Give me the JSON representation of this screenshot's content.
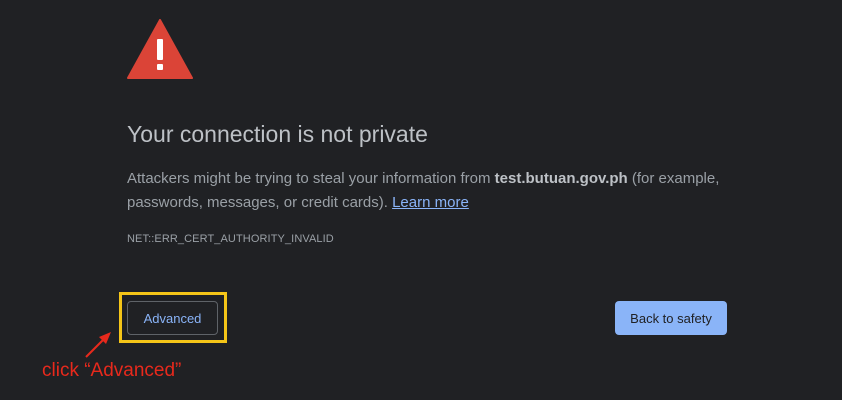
{
  "colors": {
    "background": "#202124",
    "warning_icon": "#db4437",
    "link": "#8ab4f8",
    "primary_button": "#8ab4f8",
    "highlight_box": "#f5c518",
    "annotation": "#e8291c"
  },
  "icon": {
    "warning": "warning-triangle-icon"
  },
  "title": "Your connection is not private",
  "description": {
    "prefix": "Attackers might be trying to steal your information from ",
    "host": "test.butuan.gov.ph",
    "suffix": " (for example, passwords, messages, or credit cards). ",
    "learn_more": "Learn more"
  },
  "error_code": "NET::ERR_CERT_AUTHORITY_INVALID",
  "buttons": {
    "advanced": "Advanced",
    "back_to_safety": "Back to safety"
  },
  "annotation": {
    "text": "click “Advanced”"
  }
}
